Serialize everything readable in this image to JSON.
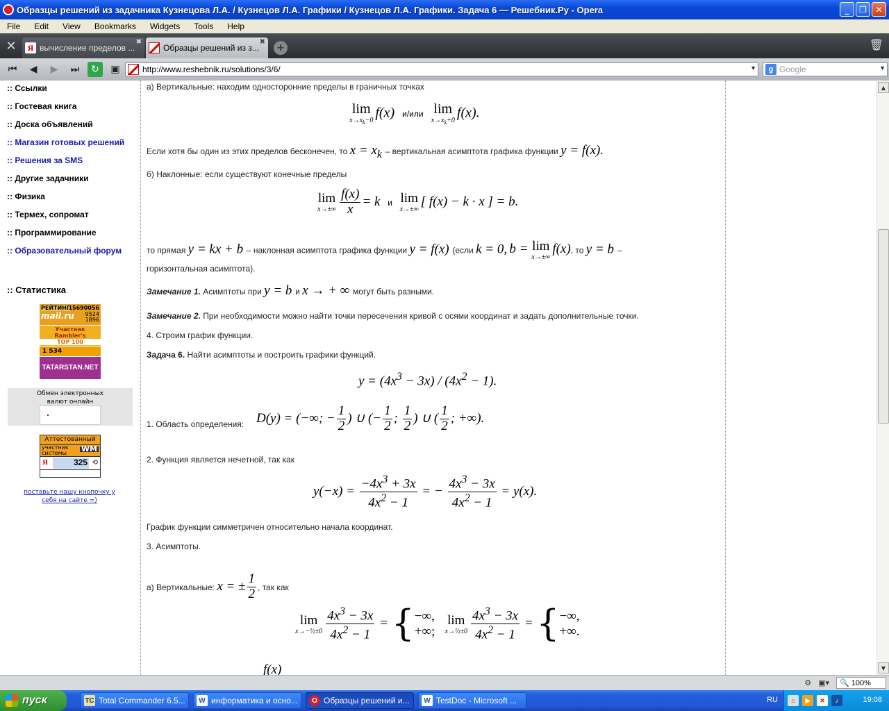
{
  "window": {
    "title": "Образцы решений из задачника Кузнецова Л.А. / Кузнецов Л.А. Графики / Кузнецов Л.А. Графики. Задача 6 — Решебник.Ру - Opera",
    "controls": {
      "minimize": "_",
      "maximize": "❐",
      "close": "✕"
    }
  },
  "menu": [
    "File",
    "Edit",
    "View",
    "Bookmarks",
    "Widgets",
    "Tools",
    "Help"
  ],
  "tabs": [
    {
      "label": "вычисление пределов ...",
      "icon": "yandex-icon",
      "icon_glyph": "Я",
      "active": false
    },
    {
      "label": "Образцы решений из з...",
      "icon": "reshebnik-icon",
      "active": true
    }
  ],
  "address": {
    "url": "http://www.reshebnik.ru/solutions/3/6/",
    "search_placeholder": "Google",
    "google_glyph": "g"
  },
  "sidebar": {
    "links": [
      {
        "label": ":: Ссылки",
        "color": "#000000"
      },
      {
        "label": ":: Гостевая книга",
        "color": "#000000"
      },
      {
        "label": ":: Доска объявлений",
        "color": "#000000"
      },
      {
        "label": ":: Магазин готовых решений",
        "color": "#1a1aa8"
      },
      {
        "label": ":: Решения за SMS",
        "color": "#1a1aa8"
      },
      {
        "label": ":: Другие задачники",
        "color": "#000000"
      },
      {
        "label": ":: Физика",
        "color": "#000000"
      },
      {
        "label": ":: Термех, сопромат",
        "color": "#000000"
      },
      {
        "label": ":: Программирование",
        "color": "#000000"
      },
      {
        "label": ":: Образовательный форум",
        "color": "#1a1aa8"
      }
    ],
    "stats_title": ":: Статистика",
    "counters": {
      "rating_label": "РЕЙТИНГ",
      "rating_value": "15690056",
      "mailru": "mail.ru",
      "mailru_v1": "9524",
      "mailru_v2": "1896",
      "rambler_l1": "Участник",
      "rambler_l2": "Rambler's",
      "rambler_l3": "TOP 100",
      "rambler_count": "1 534",
      "tatarstan": "TATARSTAN.NET"
    },
    "exchange_text": "Обмен электронных валют онлайн",
    "wm": {
      "line1": "Аттестованный",
      "line2": "участник системы",
      "logo": "WM",
      "ya": "Я",
      "num": "325"
    },
    "button_link": "поставьте нашу кнопочку у себя на сайте =)"
  },
  "content": {
    "p_vertical": "а) Вертикальные: находим односторонние пределы в граничных точках",
    "and_or": "и/или",
    "p_if_infinite_a": "Если хотя бы один из этих пределов бесконечен, то",
    "p_if_infinite_b": "– вертикальная асимптота графика функции",
    "p_oblique": "б) Наклонные: если существуют конечные пределы",
    "and": "и",
    "p_line_a": "то прямая",
    "p_line_b": "– наклонная асимптота графика функции",
    "p_line_c": "(если",
    "p_line_d": ", то",
    "p_line_e": "–",
    "p_horizontal": "горизонтальная асимптота).",
    "remark1_title": "Замечание 1.",
    "remark1_a": "Асимптоты при",
    "remark1_b": "и",
    "remark1_c": "могут быть разными.",
    "remark2_title": "Замечание 2.",
    "remark2_text": "При необходимости можно найти точки пересечения кривой с осями координат и задать дополнительные точки.",
    "step4": "4. Строим график функции.",
    "task_title": "Задача 6.",
    "task_text": "Найти асимптоты и построить графики функций.",
    "domain_label": "1. Область определения:",
    "odd_label": "2. Функция является нечетной, так как",
    "symmetric": "График функции симметричен относительно начала координат.",
    "asymptotes": "3. Асимптоты.",
    "vert_label": "а) Вертикальные:",
    "because": ", так как"
  },
  "status": {
    "zoom": "100%"
  },
  "taskbar": {
    "start": "пуск",
    "tasks": [
      {
        "label": "Total Commander 6.5...",
        "active": false
      },
      {
        "label": "информатика и осно...",
        "active": false
      },
      {
        "label": "Образцы решений и...",
        "active": true
      },
      {
        "label": "TestDoc - Microsoft ...",
        "active": false
      }
    ],
    "lang": "RU",
    "time": "19:08"
  }
}
